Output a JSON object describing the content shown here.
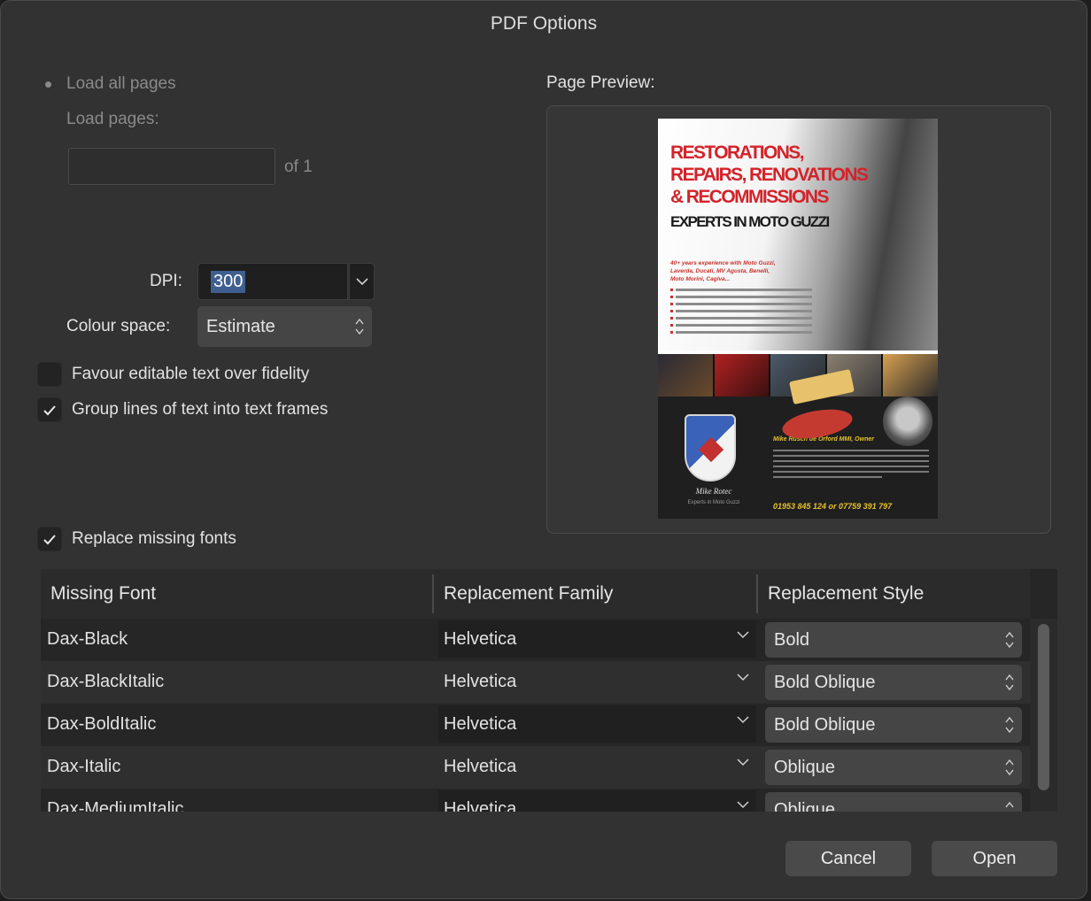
{
  "dialog": {
    "title": "PDF Options"
  },
  "pages": {
    "load_all_label": "Load all pages",
    "load_pages_label": "Load pages:",
    "pages_value": "",
    "of_label": "of 1"
  },
  "dpi": {
    "label": "DPI:",
    "value": "300"
  },
  "colour_space": {
    "label": "Colour space:",
    "value": "Estimate"
  },
  "options": {
    "favour_editable": {
      "label": "Favour editable text over fidelity",
      "checked": false
    },
    "group_lines": {
      "label": "Group lines of text into text frames",
      "checked": true
    },
    "replace_missing": {
      "label": "Replace missing fonts",
      "checked": true
    }
  },
  "preview": {
    "label": "Page Preview:",
    "flyer": {
      "line1": "RESTORATIONS,",
      "line2": "REPAIRS, RENOVATIONS",
      "line3": "& RECOMMISSIONS",
      "line4": "EXPERTS IN MOTO GUZZI",
      "sub1": "40+ years experience with Moto Guzzi,",
      "sub2": "Laverda, Ducati, MV Agusta, Benelli,",
      "sub3": "Moto Morini, Cagiva...",
      "owner": "Mike Rusch de Orford MMI, Owner",
      "signature": "Mike Rotec",
      "signature_sub": "Experts in Moto Guzzi",
      "phone": "01953 845 124 or 07759 391 797"
    }
  },
  "fonts_table": {
    "columns": [
      "Missing Font",
      "Replacement Family",
      "Replacement Style"
    ],
    "rows": [
      {
        "missing": "Dax-Black",
        "family": "Helvetica",
        "style": "Bold"
      },
      {
        "missing": "Dax-BlackItalic",
        "family": "Helvetica",
        "style": "Bold Oblique"
      },
      {
        "missing": "Dax-BoldItalic",
        "family": "Helvetica",
        "style": "Bold Oblique"
      },
      {
        "missing": "Dax-Italic",
        "family": "Helvetica",
        "style": "Oblique"
      },
      {
        "missing": "Dax-MediumItalic",
        "family": "Helvetica",
        "style": "Oblique"
      }
    ]
  },
  "buttons": {
    "cancel": "Cancel",
    "open": "Open"
  },
  "colors": {
    "accent_selection": "#3e5f8f",
    "dialog_bg": "#323232",
    "flyer_red": "#d3232a"
  }
}
